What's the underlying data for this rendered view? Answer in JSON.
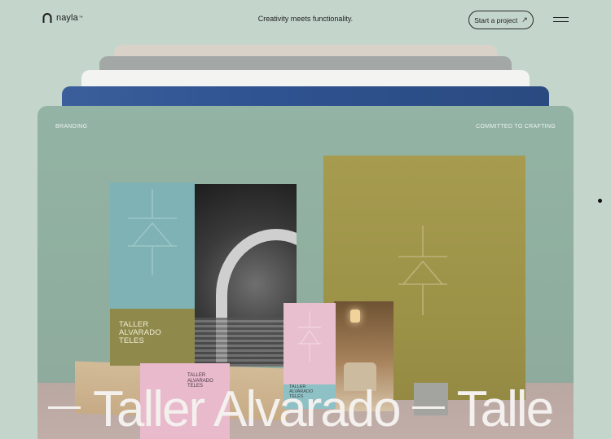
{
  "header": {
    "logo_text": "nayla",
    "logo_tm": "™",
    "tagline": "Creativity meets functionality.",
    "cta_label": "Start a project",
    "cta_icon": "arrow-up-right-icon",
    "menu_icon": "hamburger-menu-icon"
  },
  "card": {
    "category": "BRANDING",
    "motto": "COMMITTED TO CRAFTING",
    "product_text": "TALLER\nALVARADO\nTELES",
    "marquee": [
      "Taller Alvarado",
      "Talle"
    ]
  },
  "colors": {
    "background": "#c4d6cc",
    "card": "#93b3a4",
    "stack": [
      "#d9d2c9",
      "#a3a7a5",
      "#f3f3f1",
      "#2f5391"
    ]
  }
}
